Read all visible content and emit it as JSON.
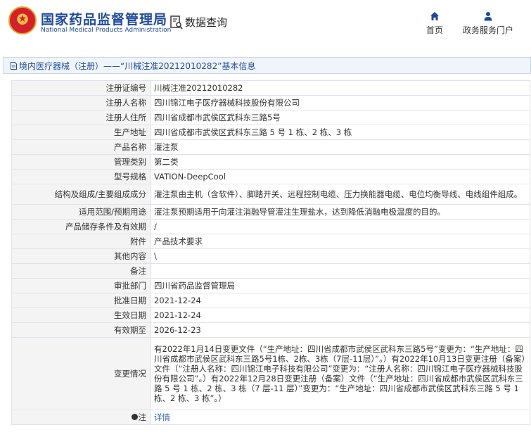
{
  "header": {
    "brand_cn": "国家药品监督管理局",
    "brand_en": "National Medical Products Administration",
    "query_label": "数据查询",
    "nav": [
      {
        "label": "首页",
        "icon": "home-icon"
      },
      {
        "label": "政务服务门户",
        "icon": "user-icon"
      }
    ]
  },
  "section": {
    "title": "境内医疗器械（注册）——“川械注准20212010282”基本信息"
  },
  "rows": [
    {
      "label": "注册证编号",
      "value": "川械注准20212010282"
    },
    {
      "label": "注册人名称",
      "value": "四川锦江电子医疗器械科技股份有限公司"
    },
    {
      "label": "注册人住所",
      "value": "四川省成都市武侯区武科东三路5号"
    },
    {
      "label": "生产地址",
      "value": "四川省成都市武侯区武科东三路 5 号 1 栋、2 栋、3 栋"
    },
    {
      "label": "产品名称",
      "value": "灌注泵"
    },
    {
      "label": "管理类别",
      "value": "第二类"
    },
    {
      "label": "型号规格",
      "value": "VATION-DeepCool"
    },
    {
      "label": "结构及组成/主要组成成分",
      "value": "灌注泵由主机（含软件）、脚踏开关、远程控制电缆、压力换能器电缆、电位均衡导线、电线组件组成。"
    },
    {
      "label": "适用范围/预期用途",
      "value": "灌注泵预期适用于向灌注消融导管灌注生理盐水，达到降低消融电极温度的目的。"
    },
    {
      "label": "产品储存条件及有效期",
      "value": "/"
    },
    {
      "label": "附件",
      "value": "产品技术要求"
    },
    {
      "label": "其他内容",
      "value": "\\"
    },
    {
      "label": "备注",
      "value": ""
    },
    {
      "label": "审批部门",
      "value": "四川省药品监督管理局"
    },
    {
      "label": "批准日期",
      "value": "2021-12-24"
    },
    {
      "label": "生效日期",
      "value": "2021-12-24"
    },
    {
      "label": "有效期至",
      "value": "2026-12-23"
    },
    {
      "label": "变更情况",
      "value": "有2022年1月14日变更文件（“生产地址：四川省成都市武侯区武科东三路5号”变更为：“生产地址：四川省成都市武侯区武科东三路5号1栋、2栋、3栋（7层-11层）”。）有2022年10月13日变更注册（备案）文件（“注册人名称：四川锦江电子科技有限公司”变更为：“注册人名称：四川锦江电子医疗器械科技股份有限公司”。）有2022年12月28日变更注册（备案）文件（“生产地址：四川省成都市武侯区武科东三路 5 号 1 栋、2 栋、3 栋（7 层-11 层）”变更为：“生产地址：四川省成都市武侯区武科东三路 5 号 1 栋、2 栋、3 栋”。）"
    },
    {
      "label": "注",
      "value": "详情"
    }
  ]
}
